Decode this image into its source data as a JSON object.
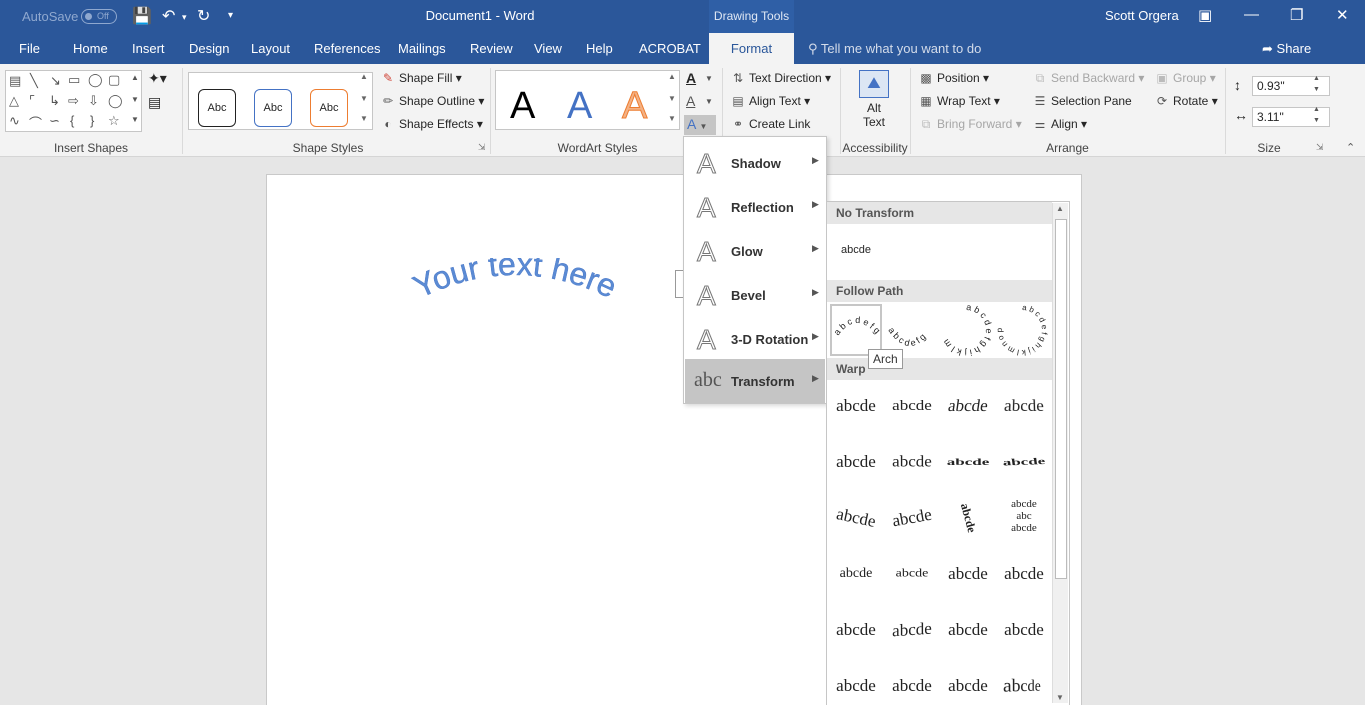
{
  "titlebar": {
    "autosave_label": "AutoSave",
    "autosave_state": "Off",
    "document_title": "Document1  -  Word",
    "context_tab": "Drawing Tools",
    "user_name": "Scott Orgera"
  },
  "tabs": [
    "File",
    "Home",
    "Insert",
    "Design",
    "Layout",
    "References",
    "Mailings",
    "Review",
    "View",
    "Help",
    "ACROBAT"
  ],
  "active_tab": "Format",
  "tell_me": "Tell me what you want to do",
  "share": "Share",
  "ribbon": {
    "groups": {
      "insert_shapes": "Insert Shapes",
      "shape_styles": "Shape Styles",
      "wordart_styles": "WordArt Styles",
      "accessibility": "Accessibility",
      "arrange": "Arrange",
      "size": "Size"
    },
    "style_preset": "Abc",
    "wordart_letter": "A",
    "shape_fill": "Shape Fill",
    "shape_outline": "Shape Outline",
    "shape_effects": "Shape Effects",
    "text_direction": "Text Direction",
    "align_text": "Align Text",
    "create_link": "Create Link",
    "alt_text_line1": "Alt",
    "alt_text_line2": "Text",
    "position": "Position",
    "wrap_text": "Wrap Text",
    "bring_forward": "Bring Forward",
    "send_backward": "Send Backward",
    "selection_pane": "Selection Pane",
    "align": "Align",
    "group": "Group",
    "rotate": "Rotate",
    "height": "0.93\"",
    "width": "3.11\""
  },
  "document": {
    "arc_text": "Your text here"
  },
  "text_effects_menu": {
    "items": [
      {
        "label": "Shadow"
      },
      {
        "label": "Reflection"
      },
      {
        "label": "Glow"
      },
      {
        "label": "Bevel"
      },
      {
        "label": "3-D Rotation"
      },
      {
        "label": "Transform"
      }
    ],
    "transform_icon_text": "abc"
  },
  "transform_gallery": {
    "no_transform_header": "No Transform",
    "no_transform_sample": "abcde",
    "follow_path_header": "Follow Path",
    "warp_header": "Warp",
    "sample": "abcde",
    "tooltip": "Arch",
    "path_samples": [
      "abcdefg",
      "abcdefg",
      "abcdefghijklm",
      "abcdefghijklmnop"
    ]
  }
}
